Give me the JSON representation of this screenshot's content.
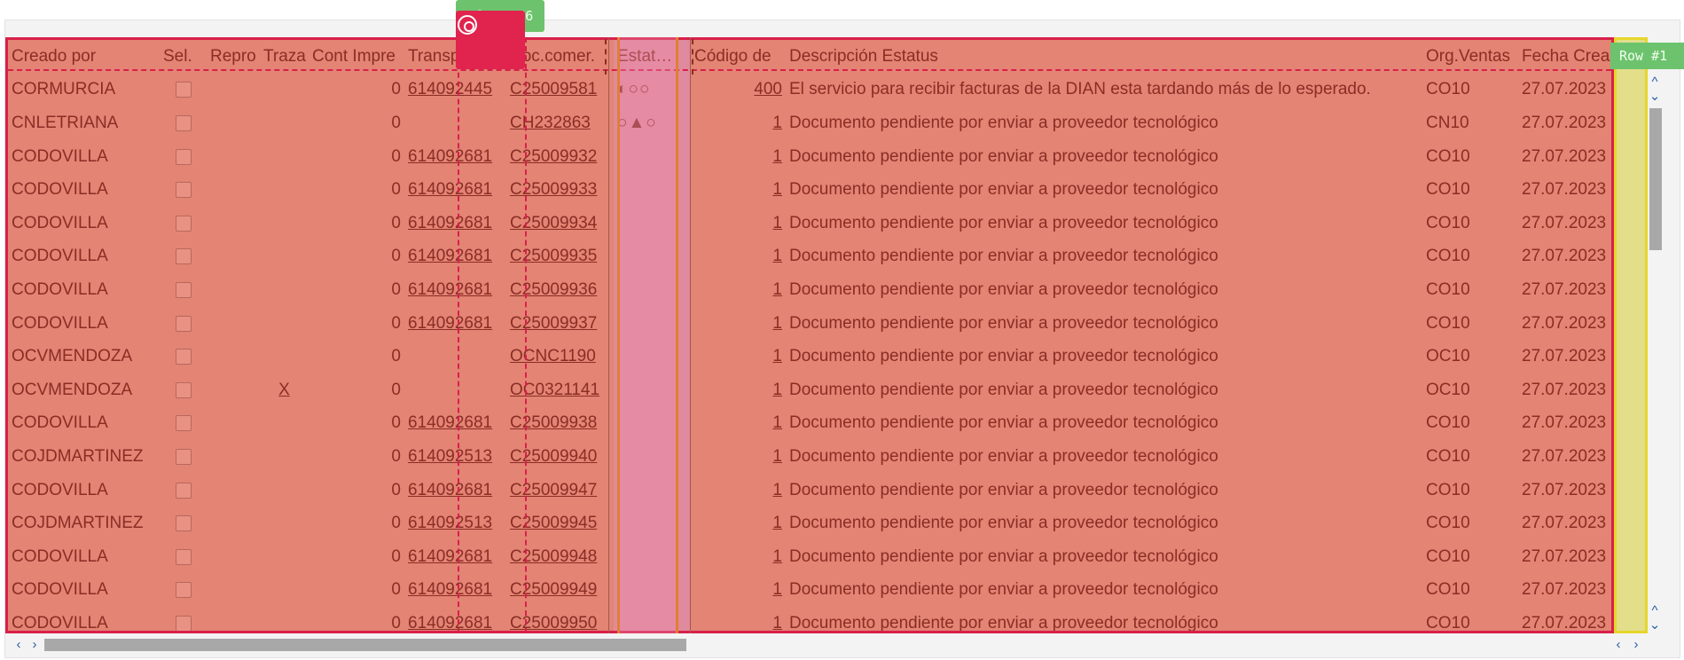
{
  "overlay": {
    "column_tag": "Column #6",
    "row_tag": "Row #1"
  },
  "columns": [
    "Creado por",
    "Sel.",
    "Repro",
    "Traza",
    "Cont Impre",
    "Transporte",
    "Doc.comer.",
    "Estat…",
    "Código de",
    "Descripción Estatus",
    "Org.Ventas",
    "Fecha Crea"
  ],
  "rows": [
    {
      "creado": "CORMURCIA",
      "traza": "",
      "cont": "0",
      "transporte": "614092445",
      "doc": "C25009581",
      "estatus": "◐○○",
      "codigo": "400",
      "desc": "El servicio para recibir facturas de la DIAN esta tardando más de lo esperado.",
      "org": "CO10",
      "fecha": "27.07.2023"
    },
    {
      "creado": "CNLETRIANA",
      "traza": "",
      "cont": "0",
      "transporte": "",
      "doc": "CH232863",
      "estatus": "○▲○",
      "codigo": "1",
      "desc": "Documento pendiente por enviar a proveedor tecnológico",
      "org": "CN10",
      "fecha": "27.07.2023"
    },
    {
      "creado": "CODOVILLA",
      "traza": "",
      "cont": "0",
      "transporte": "614092681",
      "doc": "C25009932",
      "estatus": "",
      "codigo": "1",
      "desc": "Documento pendiente por enviar a proveedor tecnológico",
      "org": "CO10",
      "fecha": "27.07.2023"
    },
    {
      "creado": "CODOVILLA",
      "traza": "",
      "cont": "0",
      "transporte": "614092681",
      "doc": "C25009933",
      "estatus": "",
      "codigo": "1",
      "desc": "Documento pendiente por enviar a proveedor tecnológico",
      "org": "CO10",
      "fecha": "27.07.2023"
    },
    {
      "creado": "CODOVILLA",
      "traza": "",
      "cont": "0",
      "transporte": "614092681",
      "doc": "C25009934",
      "estatus": "",
      "codigo": "1",
      "desc": "Documento pendiente por enviar a proveedor tecnológico",
      "org": "CO10",
      "fecha": "27.07.2023"
    },
    {
      "creado": "CODOVILLA",
      "traza": "",
      "cont": "0",
      "transporte": "614092681",
      "doc": "C25009935",
      "estatus": "",
      "codigo": "1",
      "desc": "Documento pendiente por enviar a proveedor tecnológico",
      "org": "CO10",
      "fecha": "27.07.2023"
    },
    {
      "creado": "CODOVILLA",
      "traza": "",
      "cont": "0",
      "transporte": "614092681",
      "doc": "C25009936",
      "estatus": "",
      "codigo": "1",
      "desc": "Documento pendiente por enviar a proveedor tecnológico",
      "org": "CO10",
      "fecha": "27.07.2023"
    },
    {
      "creado": "CODOVILLA",
      "traza": "",
      "cont": "0",
      "transporte": "614092681",
      "doc": "C25009937",
      "estatus": "",
      "codigo": "1",
      "desc": "Documento pendiente por enviar a proveedor tecnológico",
      "org": "CO10",
      "fecha": "27.07.2023"
    },
    {
      "creado": "OCVMENDOZA",
      "traza": "",
      "cont": "0",
      "transporte": "",
      "doc": "OCNC1190",
      "estatus": "",
      "codigo": "1",
      "desc": "Documento pendiente por enviar a proveedor tecnológico",
      "org": "OC10",
      "fecha": "27.07.2023"
    },
    {
      "creado": "OCVMENDOZA",
      "traza": "X",
      "cont": "0",
      "transporte": "",
      "doc": "OC0321141",
      "estatus": "",
      "codigo": "1",
      "desc": "Documento pendiente por enviar a proveedor tecnológico",
      "org": "OC10",
      "fecha": "27.07.2023"
    },
    {
      "creado": "CODOVILLA",
      "traza": "",
      "cont": "0",
      "transporte": "614092681",
      "doc": "C25009938",
      "estatus": "",
      "codigo": "1",
      "desc": "Documento pendiente por enviar a proveedor tecnológico",
      "org": "CO10",
      "fecha": "27.07.2023"
    },
    {
      "creado": "COJDMARTINEZ",
      "traza": "",
      "cont": "0",
      "transporte": "614092513",
      "doc": "C25009940",
      "estatus": "",
      "codigo": "1",
      "desc": "Documento pendiente por enviar a proveedor tecnológico",
      "org": "CO10",
      "fecha": "27.07.2023"
    },
    {
      "creado": "CODOVILLA",
      "traza": "",
      "cont": "0",
      "transporte": "614092681",
      "doc": "C25009947",
      "estatus": "",
      "codigo": "1",
      "desc": "Documento pendiente por enviar a proveedor tecnológico",
      "org": "CO10",
      "fecha": "27.07.2023"
    },
    {
      "creado": "COJDMARTINEZ",
      "traza": "",
      "cont": "0",
      "transporte": "614092513",
      "doc": "C25009945",
      "estatus": "",
      "codigo": "1",
      "desc": "Documento pendiente por enviar a proveedor tecnológico",
      "org": "CO10",
      "fecha": "27.07.2023"
    },
    {
      "creado": "CODOVILLA",
      "traza": "",
      "cont": "0",
      "transporte": "614092681",
      "doc": "C25009948",
      "estatus": "",
      "codigo": "1",
      "desc": "Documento pendiente por enviar a proveedor tecnológico",
      "org": "CO10",
      "fecha": "27.07.2023"
    },
    {
      "creado": "CODOVILLA",
      "traza": "",
      "cont": "0",
      "transporte": "614092681",
      "doc": "C25009949",
      "estatus": "",
      "codigo": "1",
      "desc": "Documento pendiente por enviar a proveedor tecnológico",
      "org": "CO10",
      "fecha": "27.07.2023"
    },
    {
      "creado": "CODOVILLA",
      "traza": "",
      "cont": "0",
      "transporte": "614092681",
      "doc": "C25009950",
      "estatus": "",
      "codigo": "1",
      "desc": "Documento pendiente por enviar a proveedor tecnológico",
      "org": "CO10",
      "fecha": "27.07.2023"
    }
  ],
  "scroll": {
    "up": "^",
    "down": "⌄",
    "left": "‹",
    "right": "›"
  },
  "colors": {
    "grid_overlay": "#e38474",
    "grid_border": "#d8204a",
    "row_overlay": "#e2de8a",
    "tag_green": "#6dc36d"
  }
}
